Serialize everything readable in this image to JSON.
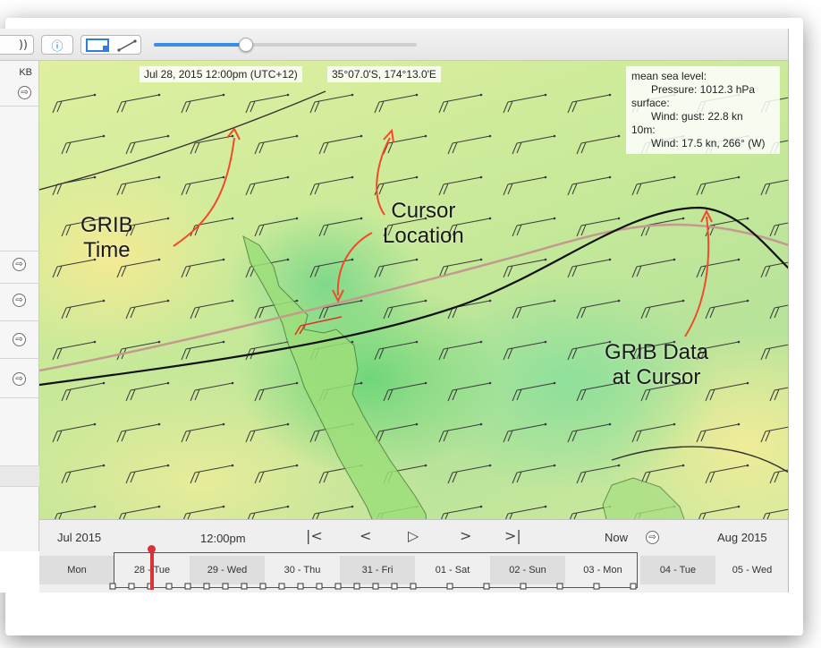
{
  "toolbar": {
    "sound_icon": "speaker-waves-icon",
    "sound_glyph": "))",
    "info_glyph": "ⓘ",
    "select_area_icon": "rectangle-select-icon",
    "measure_line_icon": "measure-line-icon",
    "time_slider_fraction": 0.35
  },
  "sidebar": {
    "size_label": "KB",
    "arrow_glyph": "⇨"
  },
  "map": {
    "grib_time": "Jul 28, 2015 12:00pm (UTC+12)",
    "cursor_location": "35°07.0'S, 174°13.0'E",
    "grib_data": {
      "line1": "mean sea level:",
      "line2": "Pressure: 1012.3 hPa",
      "line3": "surface:",
      "line4": "Wind: gust: 22.8 kn",
      "line5": "10m:",
      "line6": "Wind: 17.5 kn, 266° (W)"
    },
    "annotations": {
      "grib_time_l1": "GRIB",
      "grib_time_l2": "Time",
      "cursor_location_l1": "Cursor",
      "cursor_location_l2": "Location",
      "grib_data_l1": "GRIB Data",
      "grib_data_l2": "at Cursor"
    },
    "colors": {
      "annotation_arrow": "#f2492a",
      "isobar": "#222222",
      "track": "#c49a8f",
      "wind_barb": "#3a3a3a",
      "cursor_barb": "#e0302a"
    }
  },
  "timeline": {
    "month_left": "Jul 2015",
    "time": "12:00pm",
    "first_label": "|<",
    "prev_label": "<",
    "play_label": "▷",
    "next_label": ">",
    "last_label": ">|",
    "now_label": "Now",
    "month_right": "Aug 2015",
    "days": [
      "Mon",
      "28 - Tue",
      "29 - Wed",
      "30 - Thu",
      "31 - Fri",
      "01 - Sat",
      "02 - Sun",
      "03 - Mon",
      "04 - Tue",
      "05 - Wed"
    ],
    "marker_color": "#d9333a"
  }
}
